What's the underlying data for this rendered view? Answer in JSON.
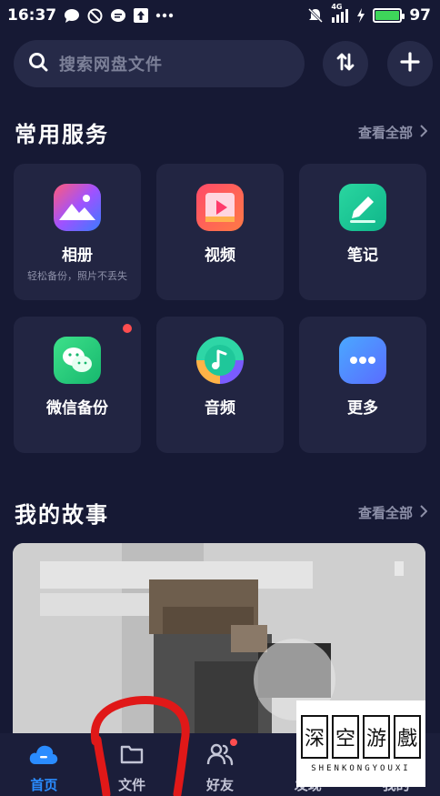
{
  "status_bar": {
    "time": "16:37",
    "network": "4G",
    "battery": "97",
    "battery_level": 0.97,
    "icons": [
      "message-icon",
      "dnd-icon",
      "chat-icon",
      "upload-icon",
      "more-dots-icon",
      "mute-icon",
      "signal-icon",
      "charging-icon",
      "battery-icon"
    ]
  },
  "search": {
    "placeholder": "搜索网盘文件"
  },
  "services": {
    "title": "常用服务",
    "see_all": "查看全部",
    "items": [
      {
        "label": "相册",
        "subtitle": "轻松备份，照片不丢失",
        "icon": "album-icon"
      },
      {
        "label": "视频",
        "icon": "video-icon"
      },
      {
        "label": "笔记",
        "icon": "note-icon"
      },
      {
        "label": "微信备份",
        "icon": "wechat-backup-icon",
        "badge": true
      },
      {
        "label": "音频",
        "icon": "audio-icon"
      },
      {
        "label": "更多",
        "icon": "more-icon"
      }
    ]
  },
  "stories": {
    "title": "我的故事",
    "see_all": "查看全部"
  },
  "bottom_nav": {
    "items": [
      {
        "label": "首页",
        "icon": "home-cloud-icon",
        "active": true
      },
      {
        "label": "文件",
        "icon": "folder-icon"
      },
      {
        "label": "好友",
        "icon": "friends-icon"
      },
      {
        "label": "发现",
        "icon": "discover-icon"
      },
      {
        "label": "我的",
        "icon": "profile-icon"
      }
    ]
  },
  "watermark": {
    "chars": [
      "深",
      "空",
      "游",
      "戲"
    ],
    "subtitle": "SHENKONGYOUXI"
  },
  "colors": {
    "background": "#161934",
    "card": "#222542",
    "accent": "#2a8cff",
    "badge": "#ff4d4f"
  }
}
